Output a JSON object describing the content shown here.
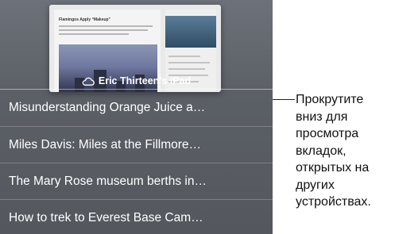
{
  "thumbnail": {
    "title": "Flamingos Apply “Makeup”"
  },
  "device": {
    "name": "Eric Thirteen’s iPad",
    "icon": "cloud-icon"
  },
  "tabs": [
    {
      "label": "Misunderstanding Orange Juice a…"
    },
    {
      "label": "Miles Davis: Miles at the Fillmore…"
    },
    {
      "label": "The Mary Rose museum berths in…"
    },
    {
      "label": "How to trek to Everest Base Cam…"
    }
  ],
  "callout": {
    "text": "Прокрутите\nвниз для\nпросмотра\nвкладок,\nоткрытых на\nдругих\nустройствах."
  },
  "colors": {
    "background": "#5e6269",
    "text": "#ffffff"
  }
}
